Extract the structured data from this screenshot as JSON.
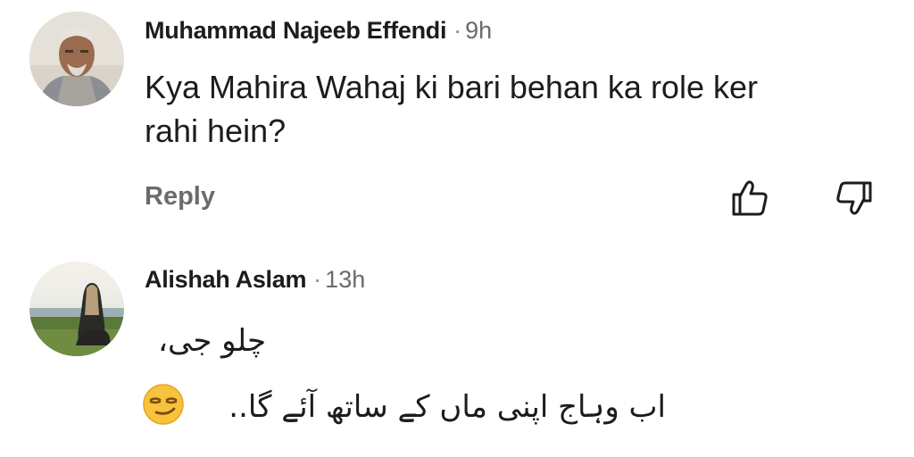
{
  "comments": [
    {
      "author": "Muhammad Najeeb Effendi",
      "separator": "·",
      "time": "9h",
      "text_line1": "Kya Mahira Wahaj ki bari behan ka role ker",
      "text_line2": "rahi hein?",
      "reply_label": "Reply"
    },
    {
      "author": "Alishah Aslam",
      "separator": "·",
      "time": "13h",
      "text_line1": "چلو جی،",
      "text_line2": "اب وہاج اپنی ماں کے ساتھ آئے گا.. "
    }
  ],
  "icons": {
    "like": "thumbs-up-icon",
    "dislike": "thumbs-down-icon",
    "emoji": "smirking-face-emoji"
  }
}
